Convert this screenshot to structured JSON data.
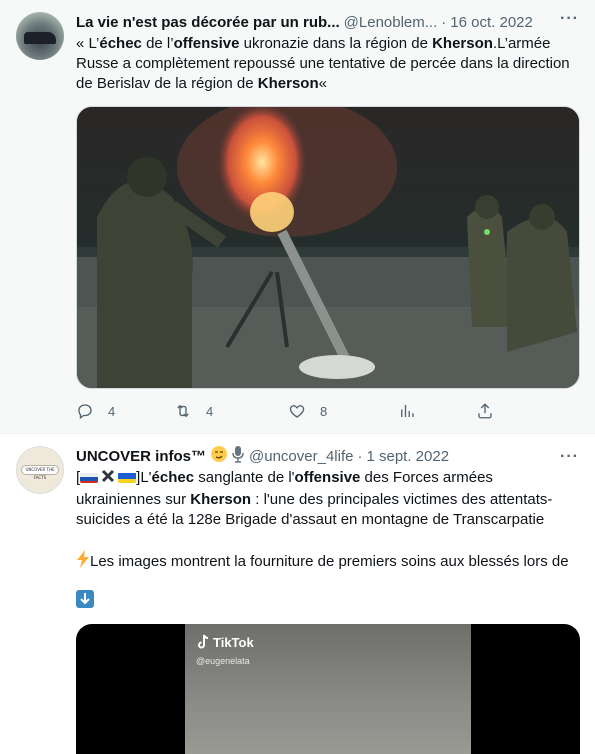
{
  "tweet1": {
    "name": "La vie n'est pas décorée par un rub...",
    "handle": "@Lenoblem...",
    "dot": "·",
    "date": "16 oct. 2022",
    "more": "···",
    "text_parts": [
      "« L’",
      "échec",
      " de l’",
      "offensive",
      " ukronazie dans la région de ",
      "Kherson",
      ".L’armée Russe a complètement repoussé une tentative de percée dans la direction de Berislav de la région de ",
      "Kherson",
      "«"
    ],
    "replies": "4",
    "retweets": "4",
    "likes": "8"
  },
  "tweet2": {
    "name": "UNCOVER infos™",
    "avatar_text": "UNCOVER THE FACTS",
    "handle": "@uncover_4life",
    "dot": "·",
    "date": "1 sept. 2022",
    "more": "···",
    "line1_parts": [
      "]L'",
      "échec",
      " sanglante de l'",
      "offensive",
      " des Forces armées ukrainiennes sur ",
      "Kherson",
      " : l'une des principales victimes des attentats-suicides a été la 128e Brigade d'assaut en montagne de Transcarpatie"
    ],
    "line2": "Les images montrent la fourniture de premiers soins aux blessés lors de",
    "tiktok_label": "TikTok",
    "tiktok_user": "@eugenelata"
  },
  "colors": {
    "secondary_text": "#536471",
    "primary_text": "#0f1419",
    "highlight_bg": "#f7f9f9",
    "accent": "#1d9bf0"
  },
  "icons": [
    "reply-icon",
    "retweet-icon",
    "like-icon",
    "views-icon",
    "share-icon",
    "more-icon",
    "lightning-icon",
    "down-arrow-icon"
  ]
}
